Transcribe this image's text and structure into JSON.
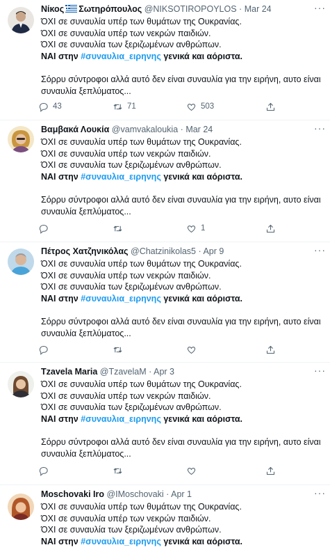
{
  "tweets": [
    {
      "name": "Νίκος",
      "name_suffix": "Σωτηρόπουλος",
      "has_flag": true,
      "handle": "@NIKSOTIROPOYLOS",
      "date": "Mar 24",
      "lines": [
        "ΌΧΙ σε συναυλία υπέρ των θυμάτων της Ουκρανίας.",
        "ΌΧΙ σε συναυλία υπέρ των νεκρών παιδιών.",
        "ΌΧΙ σε συναυλία των ξεριζωμένων ανθρώπων."
      ],
      "yes_prefix": "ΝΑΙ στην",
      "hashtag": "#συναυλια_ειρηνης",
      "yes_suffix": "γενικά και αόριστα.",
      "tail1": "Σόρρυ σύντροφοι αλλά αυτό δεν είναι συναυλία για την ειρήνη, αυτο είναι",
      "tail2": "συναυλία ξεπλύματος...",
      "replies": "43",
      "retweets": "71",
      "likes": "503"
    },
    {
      "name": "Βαμβακά Λουκία",
      "handle": "@vamvakaloukia",
      "date": "Mar 24",
      "lines": [
        "ΌΧΙ σε συναυλία υπέρ των θυμάτων της Ουκρανίας.",
        "ΌΧΙ σε συναυλία υπέρ των νεκρών παιδιών.",
        "ΌΧΙ σε συναυλία των ξεριζωμένων ανθρώπων."
      ],
      "yes_prefix": "ΝΑΙ στην",
      "hashtag": "#συναυλια_ειρηνης",
      "yes_suffix": "γενικά και αόριστα.",
      "tail1": "Σόρρυ σύντροφοι αλλά αυτό δεν είναι συναυλία για την ειρήνη, αυτο είναι",
      "tail2": "συναυλία ξεπλύματος...",
      "replies": "",
      "retweets": "",
      "likes": "1"
    },
    {
      "name": "Πέτρος Χατζηνικόλας",
      "handle": "@Chatzinikolas5",
      "date": "Apr 9",
      "lines": [
        "ΌΧΙ σε συναυλία υπέρ των θυμάτων της Ουκρανίας.",
        "ΌΧΙ σε συναυλία υπέρ των νεκρών παιδιών.",
        "ΌΧΙ σε συναυλία των ξεριζωμένων ανθρώπων."
      ],
      "yes_prefix": "ΝΑΙ στην",
      "hashtag": "#συναυλια_ειρηνης",
      "yes_suffix": "γενικά και αόριστα.",
      "tail1": "Σόρρυ σύντροφοι αλλά αυτό δεν είναι συναυλία για την ειρήνη, αυτο είναι",
      "tail2": "συναυλία ξεπλύματος...",
      "replies": "",
      "retweets": "",
      "likes": ""
    },
    {
      "name": "Tzavela Maria",
      "handle": "@TzavelaM",
      "date": "Apr 3",
      "lines": [
        "ΌΧΙ σε συναυλία υπέρ των θυμάτων της Ουκρανίας.",
        "ΌΧΙ σε συναυλία υπέρ των νεκρών παιδιών.",
        "ΌΧΙ σε συναυλία των ξεριζωμένων ανθρώπων."
      ],
      "yes_prefix": "ΝΑΙ στην",
      "hashtag": "#συναυλια_ειρηνης",
      "yes_suffix": "γενικά και αόριστα.",
      "tail1": "Σόρρυ σύντροφοι αλλά αυτό δεν είναι συναυλία για την ειρήνη, αυτο είναι",
      "tail2": "συναυλία ξεπλύματος...",
      "replies": "",
      "retweets": "",
      "likes": ""
    },
    {
      "name": "Moschovaki Iro",
      "handle": "@IMoschovaki",
      "date": "Apr 1",
      "lines": [
        "ΌΧΙ σε συναυλία υπέρ των θυμάτων της Ουκρανίας.",
        "ΌΧΙ σε συναυλία υπέρ των νεκρών παιδιών.",
        "ΌΧΙ σε συναυλία των ξεριζωμένων ανθρώπων."
      ],
      "yes_prefix": "ΝΑΙ στην",
      "hashtag": "#συναυλια_ειρηνης",
      "yes_suffix": "γενικά και αόριστα."
    }
  ],
  "more_glyph": "···",
  "colors": {
    "link": "#1d9bf0",
    "secondary": "#536471",
    "divider": "#eff3f4"
  },
  "icons": {
    "reply": "reply-icon",
    "retweet": "retweet-icon",
    "like": "heart-icon",
    "share": "share-icon",
    "more": "more-icon"
  }
}
